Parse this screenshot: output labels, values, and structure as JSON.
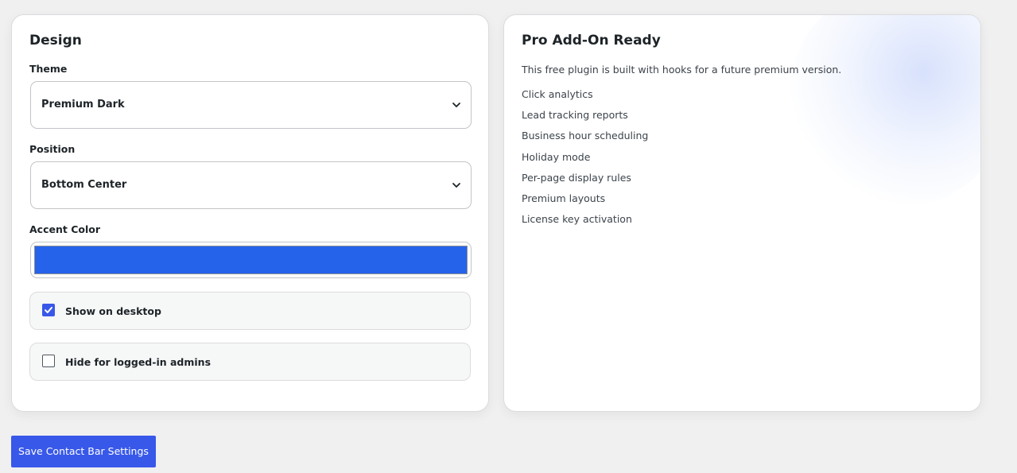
{
  "design": {
    "title": "Design",
    "theme": {
      "label": "Theme",
      "value": "Premium Dark"
    },
    "position": {
      "label": "Position",
      "value": "Bottom Center"
    },
    "accent": {
      "label": "Accent Color",
      "color": "#2563eb"
    },
    "show_desktop": {
      "label": "Show on desktop",
      "checked": true
    },
    "hide_admins": {
      "label": "Hide for logged-in admins",
      "checked": false
    }
  },
  "pro": {
    "title": "Pro Add-On Ready",
    "description": "This free plugin is built with hooks for a future premium version.",
    "features": [
      "Click analytics",
      "Lead tracking reports",
      "Business hour scheduling",
      "Holiday mode",
      "Per-page display rules",
      "Premium layouts",
      "License key activation"
    ]
  },
  "save_button": "Save Contact Bar Settings",
  "colors": {
    "primary": "#3858e9",
    "accent_swatch": "#2563eb"
  }
}
